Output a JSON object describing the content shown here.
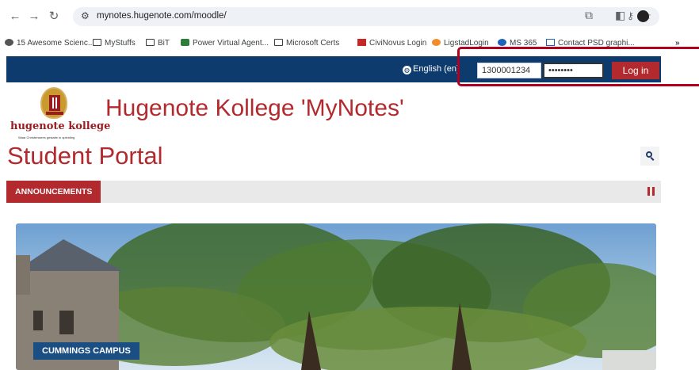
{
  "browser": {
    "url": "mynotes.hugenote.com/moodle/",
    "bookmarks": [
      "15 Awesome Scienc...",
      "MyStuffs",
      "BiT",
      "Power Virtual Agent...",
      "Microsoft Certs",
      "CiviNovus Login",
      "LigstadLogin",
      "MS 365",
      "Contact PSD graphi...",
      "»"
    ]
  },
  "navbar": {
    "language": "English (en)",
    "username_value": "1300001234",
    "password_value": "••••••••",
    "login_label": "Log in"
  },
  "header": {
    "logo_name": "hugenote kollege",
    "logo_tagline": "Waar Christenwees gestalte in opleiding",
    "site_title": "Hugenote Kollege 'MyNotes'",
    "portal_title": "Student Portal"
  },
  "announcements": {
    "tab_label": "ANNOUNCEMENTS"
  },
  "hero": {
    "caption": "CUMMINGS CAMPUS"
  },
  "colors": {
    "navbar": "#0d3b6e",
    "accent_red": "#b22a2e",
    "highlight_box": "#b00020"
  }
}
